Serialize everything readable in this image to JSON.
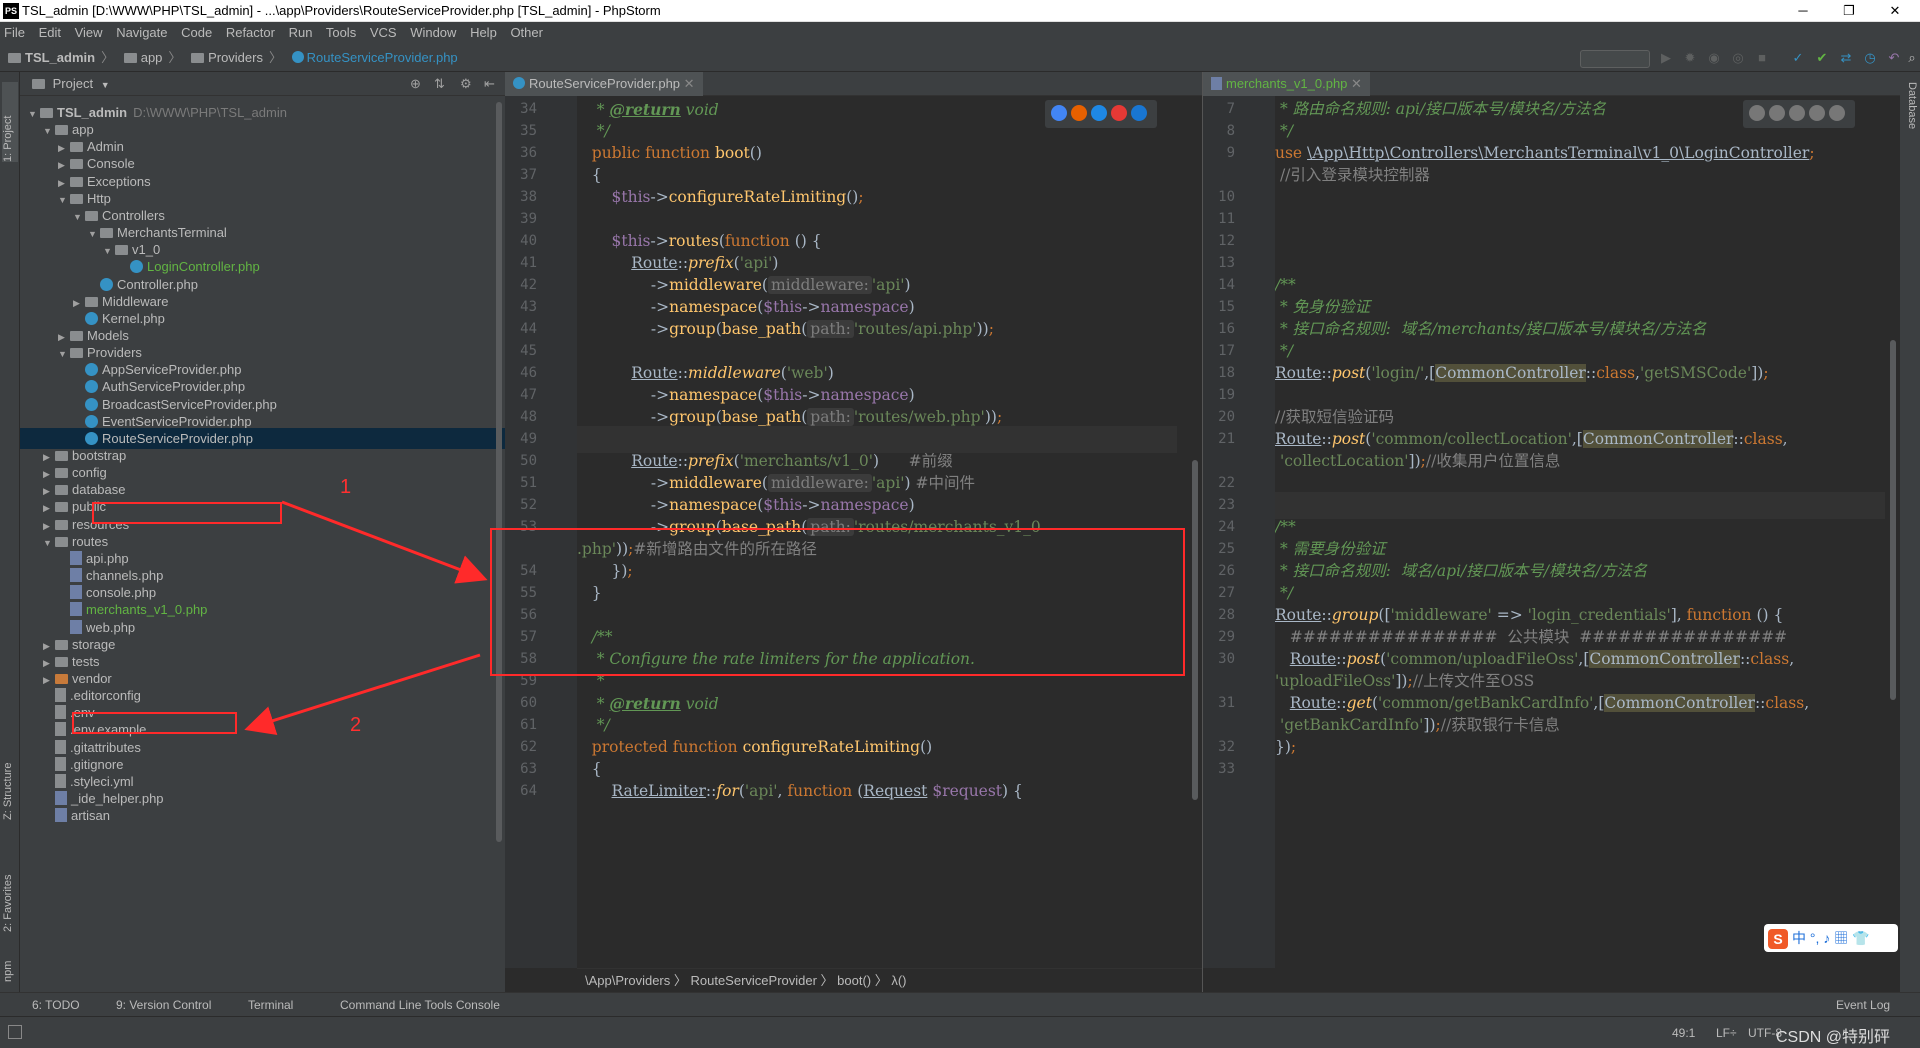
{
  "window": {
    "title": "TSL_admin [D:\\WWW\\PHP\\TSL_admin] - ...\\app\\Providers\\RouteServiceProvider.php [TSL_admin] - PhpStorm",
    "app_icon": "PS",
    "minimize": "─",
    "maximize": "❐",
    "close": "✕"
  },
  "menu": [
    "File",
    "Edit",
    "View",
    "Navigate",
    "Code",
    "Refactor",
    "Run",
    "Tools",
    "VCS",
    "Window",
    "Help",
    "Other"
  ],
  "nav": {
    "crumbs": [
      "TSL_admin",
      "app",
      "Providers",
      "RouteServiceProvider.php"
    ]
  },
  "left_tabs": {
    "project": "1: Project",
    "structure": "Z: Structure",
    "favorites": "2: Favorites",
    "npm": "npm"
  },
  "right_tabs": {
    "database": "Database"
  },
  "project_panel": {
    "title": "Project",
    "rows": [
      {
        "label": "TSL_admin",
        "extra": "D:\\WWW\\PHP\\TSL_admin",
        "type": "root"
      },
      {
        "label": "app",
        "type": "folder"
      },
      {
        "label": "Admin",
        "type": "folder"
      },
      {
        "label": "Console",
        "type": "folder"
      },
      {
        "label": "Exceptions",
        "type": "folder"
      },
      {
        "label": "Http",
        "type": "folder"
      },
      {
        "label": "Controllers",
        "type": "folder"
      },
      {
        "label": "MerchantsTerminal",
        "type": "folder"
      },
      {
        "label": "v1_0",
        "type": "folder"
      },
      {
        "label": "LoginController.php",
        "type": "class"
      },
      {
        "label": "Controller.php",
        "type": "class"
      },
      {
        "label": "Middleware",
        "type": "folder"
      },
      {
        "label": "Kernel.php",
        "type": "class"
      },
      {
        "label": "Models",
        "type": "folder"
      },
      {
        "label": "Providers",
        "type": "folder"
      },
      {
        "label": "AppServiceProvider.php",
        "type": "class"
      },
      {
        "label": "AuthServiceProvider.php",
        "type": "class"
      },
      {
        "label": "BroadcastServiceProvider.php",
        "type": "class"
      },
      {
        "label": "EventServiceProvider.php",
        "type": "class"
      },
      {
        "label": "RouteServiceProvider.php",
        "type": "class"
      },
      {
        "label": "bootstrap",
        "type": "folder"
      },
      {
        "label": "config",
        "type": "folder"
      },
      {
        "label": "database",
        "type": "folder"
      },
      {
        "label": "public",
        "type": "folder"
      },
      {
        "label": "resources",
        "type": "folder"
      },
      {
        "label": "routes",
        "type": "folder"
      },
      {
        "label": "api.php",
        "type": "php"
      },
      {
        "label": "channels.php",
        "type": "php"
      },
      {
        "label": "console.php",
        "type": "php"
      },
      {
        "label": "merchants_v1_0.php",
        "type": "php"
      },
      {
        "label": "web.php",
        "type": "php"
      },
      {
        "label": "storage",
        "type": "folder"
      },
      {
        "label": "tests",
        "type": "folder"
      },
      {
        "label": "vendor",
        "type": "folder"
      },
      {
        "label": ".editorconfig",
        "type": "file"
      },
      {
        "label": ".env",
        "type": "file"
      },
      {
        "label": ".env.example",
        "type": "file"
      },
      {
        "label": ".gitattributes",
        "type": "file"
      },
      {
        "label": ".gitignore",
        "type": "file"
      },
      {
        "label": ".styleci.yml",
        "type": "file"
      },
      {
        "label": "_ide_helper.php",
        "type": "php"
      },
      {
        "label": "artisan",
        "type": "php"
      }
    ]
  },
  "editor_left": {
    "tab": "RouteServiceProvider.php",
    "line_numbers": [
      "34",
      "35",
      "36",
      "37",
      "38",
      "39",
      "40",
      "41",
      "42",
      "43",
      "44",
      "45",
      "46",
      "47",
      "48",
      "49",
      "50",
      "51",
      "52",
      "53",
      "",
      "54",
      "55",
      "56",
      "57",
      "58",
      "59",
      "60",
      "61",
      "62",
      "63",
      "64"
    ],
    "breadcrumb": "\\App\\Providers 〉 RouteServiceProvider 〉 boot() 〉 λ()"
  },
  "editor_right": {
    "tab": "merchants_v1_0.php",
    "line_numbers": [
      "7",
      "8",
      "9",
      "",
      "10",
      "11",
      "12",
      "13",
      "14",
      "15",
      "16",
      "17",
      "18",
      "19",
      "20",
      "21",
      "",
      "22",
      "23",
      "24",
      "25",
      "26",
      "27",
      "28",
      "29",
      "30",
      "",
      "31",
      "",
      "32",
      "33"
    ]
  },
  "annotations": {
    "one": "1",
    "two": "2"
  },
  "status": {
    "todo": "6: TODO",
    "vcs": "9: Version Control",
    "terminal": "Terminal",
    "cli": "Command Line Tools Console",
    "event_log": "Event Log",
    "position": "49:1",
    "line_sep": "LF÷",
    "encoding": "UTF-8",
    "watermark": "CSDN @特别砰"
  },
  "ime": {
    "label": "中 °, ♪ ▦ 👕"
  },
  "colors": {
    "accent": "#3592c4",
    "annotation_red": "#ff2a2a",
    "selection": "#0d293e"
  }
}
